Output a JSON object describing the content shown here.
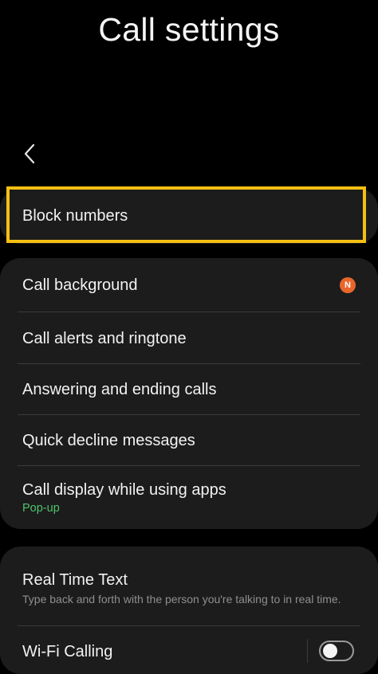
{
  "header": {
    "title": "Call settings"
  },
  "icons": {
    "back": "chevron-left-icon"
  },
  "block_card": {
    "label": "Block numbers"
  },
  "main_card": {
    "items": [
      {
        "label": "Call background",
        "badge": "N"
      },
      {
        "label": "Call alerts and ringtone"
      },
      {
        "label": "Answering and ending calls"
      },
      {
        "label": "Quick decline messages"
      },
      {
        "label": "Call display while using apps",
        "sub": "Pop-up"
      }
    ]
  },
  "rtt_card": {
    "items": [
      {
        "label": "Real Time Text",
        "desc": "Type back and forth with the person you're talking to in real time."
      },
      {
        "label": "Wi-Fi Calling",
        "toggle": false
      }
    ]
  },
  "colors": {
    "highlight": "#f4bf12",
    "badge": "#e8662b",
    "subtext_green": "#4fc36b",
    "card_bg": "#1c1c1c"
  }
}
